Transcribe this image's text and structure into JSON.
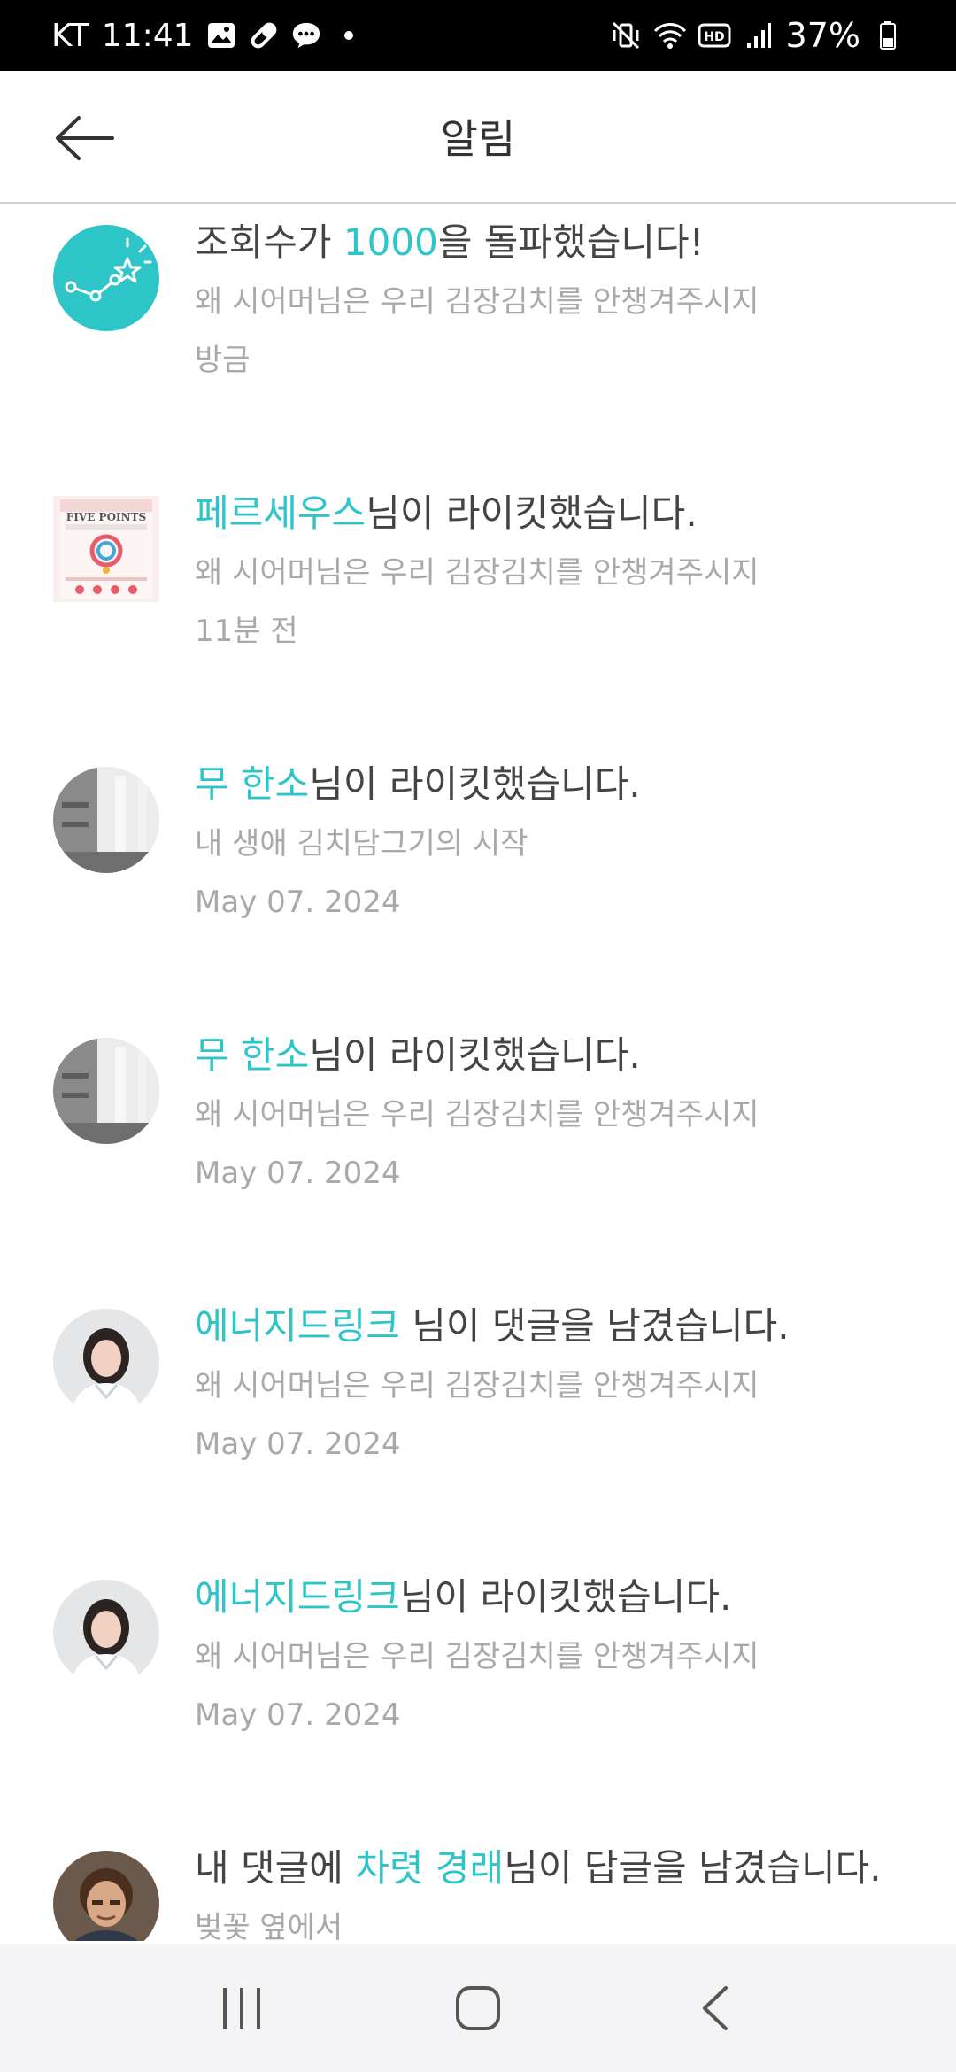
{
  "status_bar": {
    "carrier": "KT",
    "time": "11:41",
    "battery": "37%",
    "left_icons": [
      "gallery-icon",
      "link-icon",
      "chat-bubble-icon",
      "dot-icon"
    ],
    "right_icons": [
      "mute-vibrate-icon",
      "wifi-icon",
      "hd-icon",
      "signal-icon",
      "battery-icon"
    ]
  },
  "header": {
    "title": "알림",
    "back_icon": "arrow-left-icon"
  },
  "notifications": [
    {
      "avatar": "trending-star-icon",
      "parts": [
        {
          "text": "조회수가 ",
          "highlight": false
        },
        {
          "text": "1000",
          "highlight": true
        },
        {
          "text": "을 돌파했습니다!",
          "highlight": false
        }
      ],
      "subtitle": "왜 시어머님은 우리 김장김치를 안챙겨주시지",
      "time": "방금"
    },
    {
      "avatar": "book-cover-five-points",
      "avatar_caption": "FIVE POINTS",
      "parts": [
        {
          "text": "페르세우스",
          "highlight": true
        },
        {
          "text": "님이 라이킷했습니다.",
          "highlight": false
        }
      ],
      "subtitle": "왜 시어머님은 우리 김장김치를 안챙겨주시지",
      "time": "11분 전"
    },
    {
      "avatar": "photo-room",
      "parts": [
        {
          "text": "무 한소",
          "highlight": true
        },
        {
          "text": "님이 라이킷했습니다.",
          "highlight": false
        }
      ],
      "subtitle": "내 생애 김치담그기의 시작",
      "time": "May 07. 2024"
    },
    {
      "avatar": "photo-room",
      "parts": [
        {
          "text": "무 한소",
          "highlight": true
        },
        {
          "text": "님이 라이킷했습니다.",
          "highlight": false
        }
      ],
      "subtitle": "왜 시어머님은 우리 김장김치를 안챙겨주시지",
      "time": "May 07. 2024"
    },
    {
      "avatar": "photo-woman",
      "parts": [
        {
          "text": "에너지드링크",
          "highlight": true
        },
        {
          "text": " 님이 댓글을 남겼습니다.",
          "highlight": false
        }
      ],
      "subtitle": "왜 시어머님은 우리 김장김치를 안챙겨주시지",
      "time": "May 07. 2024"
    },
    {
      "avatar": "photo-woman",
      "parts": [
        {
          "text": "에너지드링크",
          "highlight": true
        },
        {
          "text": "님이 라이킷했습니다.",
          "highlight": false
        }
      ],
      "subtitle": "왜 시어머님은 우리 김장김치를 안챙겨주시지",
      "time": "May 07. 2024"
    },
    {
      "avatar": "photo-man",
      "parts": [
        {
          "text": "내 댓글에 ",
          "highlight": false
        },
        {
          "text": "차렷 경래",
          "highlight": true
        },
        {
          "text": "님이 답글을 남겼습니다.",
          "highlight": false
        }
      ],
      "subtitle": "벚꽃 옆에서",
      "time": ""
    }
  ],
  "nav_bar": {
    "recent_icon": "recent-apps-icon",
    "home_icon": "home-icon",
    "back_icon": "back-chevron-icon"
  },
  "colors": {
    "accent": "#2ec5c9",
    "title_text": "#444444",
    "secondary_text": "#a9a9a9",
    "divider": "#cfcfcf",
    "status_bar_bg": "#000000",
    "nav_bar_bg": "#f4f4f6"
  }
}
